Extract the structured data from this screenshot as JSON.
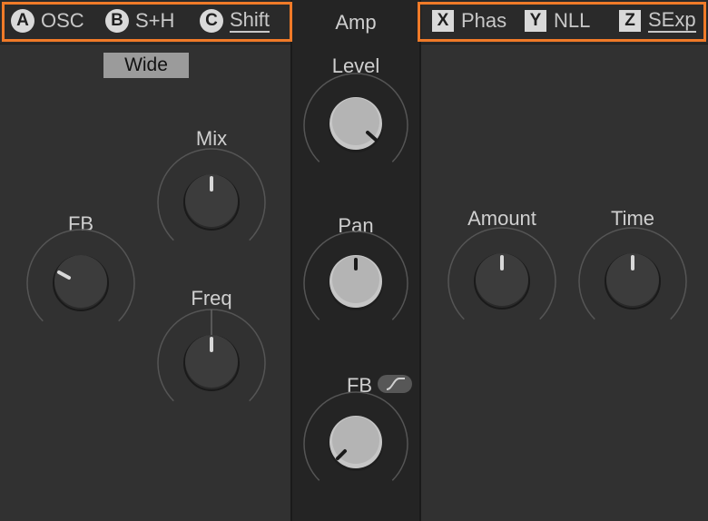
{
  "left": {
    "tabs": [
      {
        "letter": "A",
        "label": "OSC"
      },
      {
        "letter": "B",
        "label": "S+H"
      },
      {
        "letter": "C",
        "label": "Shift"
      }
    ],
    "mode_button": "Wide",
    "knobs": {
      "mix": "Mix",
      "fb": "FB",
      "freq": "Freq"
    }
  },
  "mid": {
    "title": "Amp",
    "knobs": {
      "level": "Level",
      "pan": "Pan",
      "fb": "FB"
    }
  },
  "right": {
    "tabs": [
      {
        "letter": "X",
        "label": "Phas"
      },
      {
        "letter": "Y",
        "label": "NLL"
      },
      {
        "letter": "Z",
        "label": "SExp"
      }
    ],
    "knobs": {
      "amount": "Amount",
      "time": "Time"
    }
  },
  "colors": {
    "highlight": "#f07a28",
    "panel": "#313131",
    "center": "#242424"
  }
}
